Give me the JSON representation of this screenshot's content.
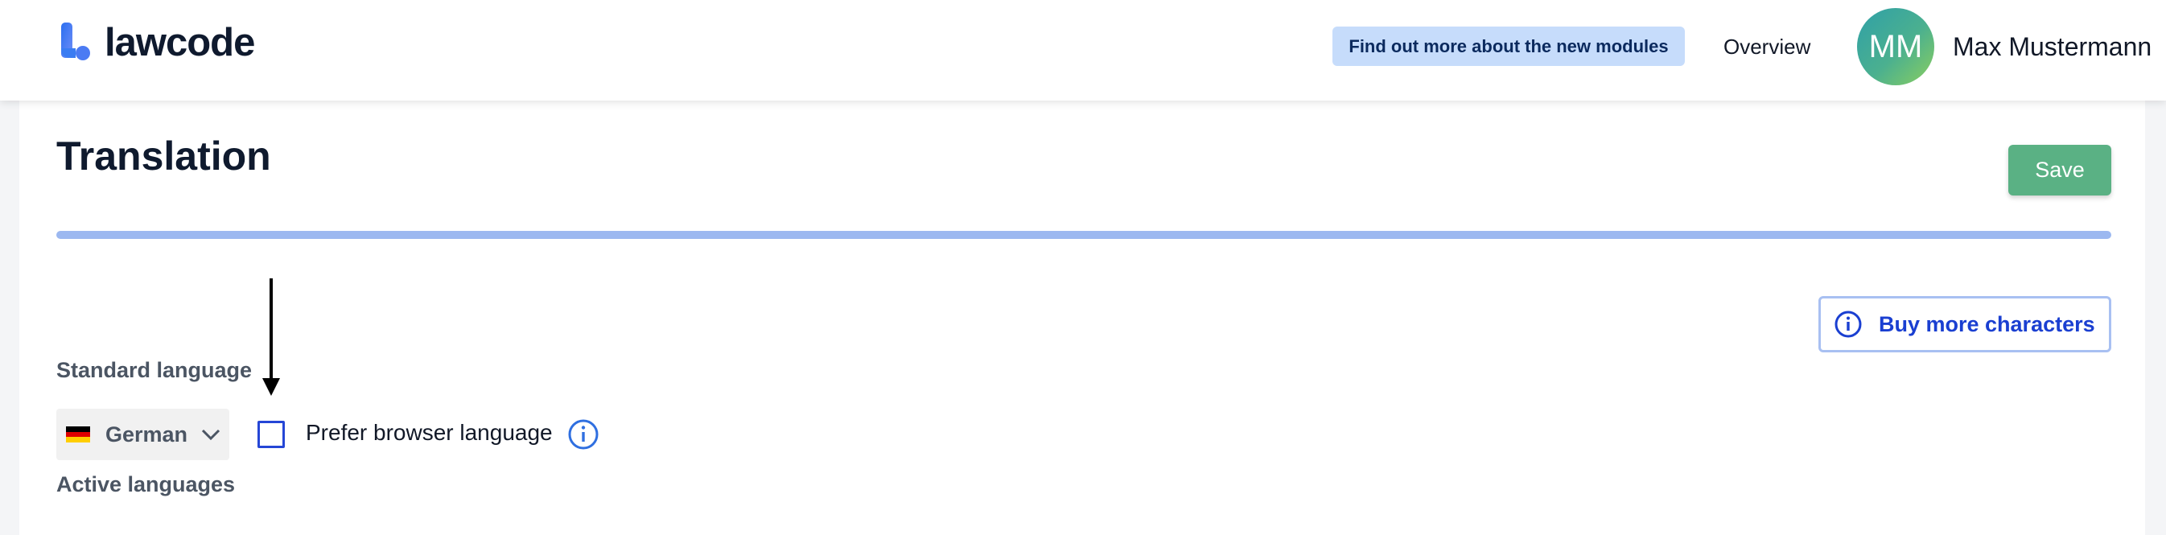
{
  "header": {
    "logo_text": "lawcode",
    "promo_label": "Find out more about the new modules",
    "nav_overview": "Overview",
    "avatar_initials": "MM",
    "user_name": "Max Mustermann"
  },
  "page": {
    "title": "Translation",
    "save_label": "Save",
    "buy_label": "Buy more characters",
    "buy_icon": "info-circle-icon",
    "standard_language_label": "Standard language",
    "selected_language": "German",
    "flag_icon": "german-flag-icon",
    "prefer_browser_label": "Prefer browser language",
    "prefer_browser_checked": false,
    "active_languages_label": "Active languages"
  },
  "colors": {
    "save": "#5ab184",
    "accent_blue": "#2546d6",
    "promo_bg": "#c6dcfb",
    "progress": "#9cb8f0"
  }
}
